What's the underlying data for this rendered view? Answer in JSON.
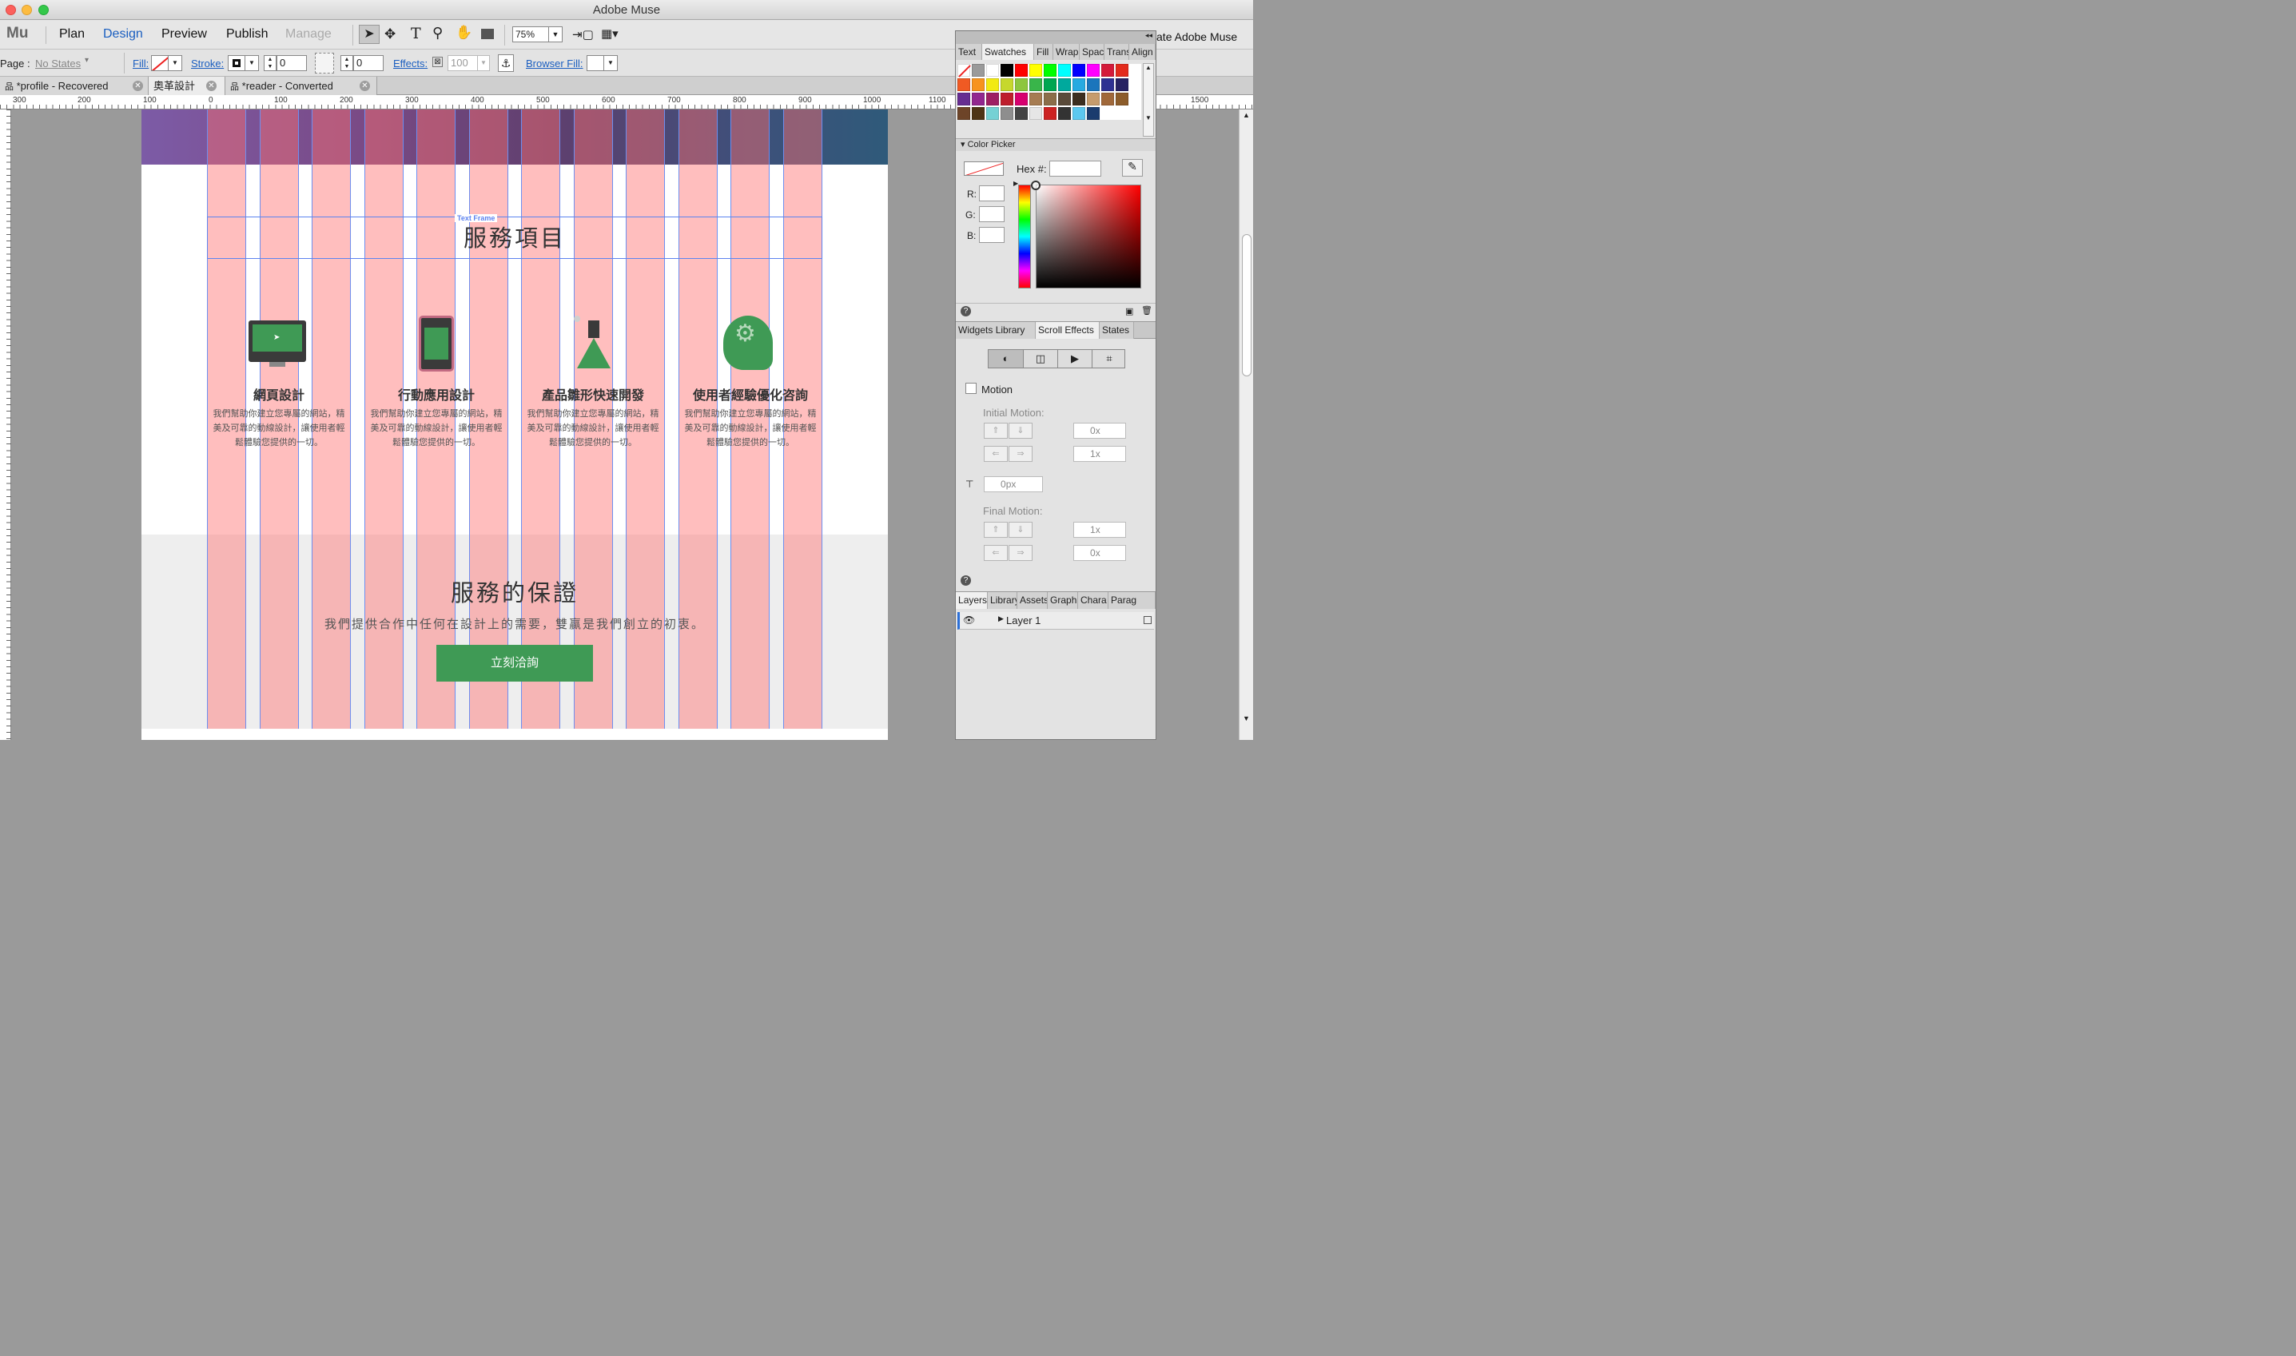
{
  "window": {
    "title": "Adobe Muse"
  },
  "menu": {
    "logo": "Mu",
    "items": [
      "Plan",
      "Design",
      "Preview",
      "Publish",
      "Manage"
    ],
    "zoom": "75%"
  },
  "props": {
    "page_label": "Page :",
    "page_state": "No States",
    "fill": "Fill:",
    "stroke": "Stroke:",
    "stroke_value": "0",
    "corner_value": "0",
    "effects": "Effects:",
    "effects_value": "100",
    "browser_fill": "Browser Fill:"
  },
  "tabs": [
    {
      "label": "*profile - Recovered"
    },
    {
      "label": "奧革設計"
    },
    {
      "label": "*reader - Converted"
    }
  ],
  "ruler": [
    "300",
    "200",
    "100",
    "0",
    "100",
    "200",
    "300",
    "400",
    "500",
    "600",
    "700",
    "800",
    "900",
    "1000",
    "1100",
    "1500"
  ],
  "page": {
    "frame_tag": "Text Frame",
    "services_title": "服務項目",
    "services": [
      {
        "icon": "monitor-icon",
        "title": "網頁設計",
        "desc": "我們幫助你建立您專屬的網站，精美及可靠的動線設計，讓使用者輕鬆體驗您提供的一切。"
      },
      {
        "icon": "tablet-icon",
        "title": "行動應用設計",
        "desc": "我們幫助你建立您專屬的網站，精美及可靠的動線設計，讓使用者輕鬆體驗您提供的一切。"
      },
      {
        "icon": "flask-icon",
        "title": "產品雛形快速開發",
        "desc": "我們幫助你建立您專屬的網站，精美及可靠的動線設計，讓使用者輕鬆體驗您提供的一切。"
      },
      {
        "icon": "head-gear-icon",
        "title": "使用者經驗優化咨詢",
        "desc": "我們幫助你建立您專屬的網站，精美及可靠的動線設計，讓使用者輕鬆體驗您提供的一切。"
      }
    ],
    "guarantee_title": "服務的保證",
    "guarantee_sub": "我們提供合作中任何在設計上的需要，雙贏是我們創立的初衷。",
    "cta": "立刻洽詢"
  },
  "panel": {
    "header_fragment": "ate Adobe Muse",
    "top_tabs": [
      "Text",
      "Swatches",
      "Fill",
      "Wrap",
      "Spac",
      "Trans",
      "Align"
    ],
    "swatches": [
      "#ffffff",
      "#9a9a9a",
      "#ffffff",
      "#000000",
      "#ff0000",
      "#ffff00",
      "#00ff00",
      "#00ffff",
      "#0000ff",
      "#ff00ff",
      "#d41a3a",
      "#e32b1c",
      "#f05a23",
      "#f7931e",
      "#f2ea12",
      "#c6d82d",
      "#8dc63f",
      "#39b54a",
      "#00a651",
      "#00a99d",
      "#27aae1",
      "#1b75bc",
      "#2e3192",
      "#262262",
      "#662d91",
      "#92278f",
      "#9e1f63",
      "#be1e2d",
      "#d7006f",
      "#a67c52",
      "#8b6e4a",
      "#594a3a",
      "#3c2e20",
      "#c69c6d",
      "#a0683a",
      "#8c5c2a",
      "#6d4428",
      "#4e3416",
      "#75d1d4",
      "#8e8e8e",
      "#444444",
      "#e6e6e6",
      "#cc2222",
      "#333333",
      "#5cc8f0",
      "#1b3c6e"
    ],
    "color_picker": {
      "title": "Color Picker",
      "hex_label": "Hex #:",
      "r": "R:",
      "g": "G:",
      "b": "B:"
    },
    "mid_tabs": [
      "Widgets Library",
      "Scroll Effects",
      "States"
    ],
    "motion": {
      "label": "Motion",
      "initial": "Initial Motion:",
      "final": "Final Motion:",
      "val_0x": "0x",
      "val_1x": "1x",
      "val_px": "0px",
      "val_1x_b": "1x",
      "val_0x_b": "0x"
    },
    "bottom_tabs": [
      "Layers",
      "Library",
      "Assets",
      "Graphi",
      "Chara",
      "Parag"
    ],
    "layer": "Layer 1"
  },
  "colors": {
    "accent_green": "#3f9a55",
    "guide_pink": "#ff6e6e",
    "guide_blue": "#6d8ff0"
  }
}
